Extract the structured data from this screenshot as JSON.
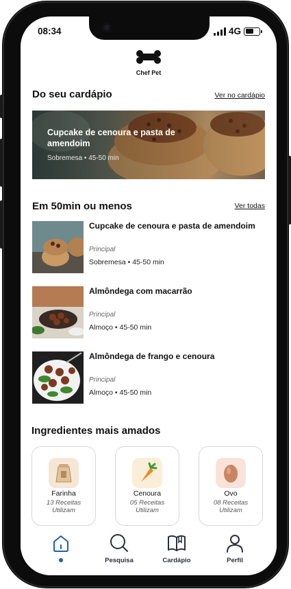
{
  "status_bar": {
    "time": "08:34",
    "network": "4G"
  },
  "app": {
    "name": "Chef Pet"
  },
  "menu_section": {
    "title": "Do seu cardápio",
    "link": "Ver no cardápio",
    "featured": {
      "title": "Cupcake de cenoura e pasta de amendoim",
      "meta": "Sobremesa • 45-50 min"
    }
  },
  "quick_section": {
    "title": "Em 50min ou menos",
    "link": "Ver todas",
    "recipes": [
      {
        "title": "Cupcake de cenoura e pasta de amendoim",
        "category": "Principal",
        "meta": "Sobremesa • 45-50 min"
      },
      {
        "title": "Almôndega com macarrão",
        "category": "Principal",
        "meta": "Almoço • 45-50 min"
      },
      {
        "title": "Almôndega de frango e cenoura",
        "category": "Principal",
        "meta": "Almoço • 45-50 min"
      }
    ]
  },
  "ingredients_section": {
    "title": "Ingredientes mais amados",
    "items": [
      {
        "name": "Farinha",
        "count": "13 Receitas Utilizam",
        "icon": "flour-sack-icon"
      },
      {
        "name": "Cenoura",
        "count": "05 Receitas Utilizam",
        "icon": "carrot-icon"
      },
      {
        "name": "Ovo",
        "count": "08 Receitas Utilizam",
        "icon": "egg-icon"
      }
    ]
  },
  "tabbar": {
    "active": "home",
    "items": [
      {
        "id": "home",
        "label": "",
        "icon": "home-icon"
      },
      {
        "id": "search",
        "label": "Pesquisa",
        "icon": "search-icon"
      },
      {
        "id": "menu",
        "label": "Cardápio",
        "icon": "book-icon"
      },
      {
        "id": "profile",
        "label": "Perfil",
        "icon": "user-icon"
      }
    ]
  },
  "colors": {
    "accent": "#1f5fa8",
    "text": "#111111"
  }
}
